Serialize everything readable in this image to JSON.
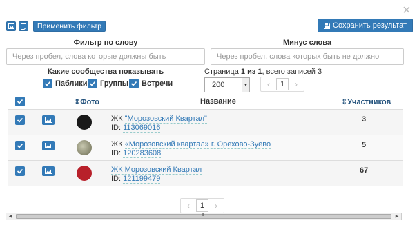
{
  "toolbar": {
    "filter_button": "Применить фильтр",
    "save_button": "Сохранить результат",
    "close_symbol": "×"
  },
  "filters": {
    "word_label": "Фильтр по слову",
    "word_placeholder": "Через пробел, слова которые должны быть",
    "minus_label": "Минус слова",
    "minus_placeholder": "Через пробел, слова которых быть не должно",
    "communities_label": "Какие сообщества показывать",
    "types": [
      {
        "label": "Паблики",
        "checked": true
      },
      {
        "label": "Группы",
        "checked": true
      },
      {
        "label": "Встречи",
        "checked": true
      }
    ]
  },
  "paging": {
    "info_prefix": "Страница ",
    "current": "1",
    "of_word": " из ",
    "total": "1",
    "records_text": ", всего записей 3",
    "per_page": "200",
    "page_number": "1",
    "prev_symbol": "‹",
    "next_symbol": "›"
  },
  "table": {
    "col_photo": "Фото",
    "col_name": "Название",
    "col_members": "Участников",
    "rows": [
      {
        "prefix": "ЖК ",
        "link": "\"Морозовский Квартал\"",
        "suffix": "",
        "id": "113069016",
        "members": "3",
        "avatar_color": "#1a1a1a"
      },
      {
        "prefix": "ЖК ",
        "link": "«Морозовский квартал» г. Орехово-Зуево",
        "suffix": "",
        "id": "120283608",
        "members": "5",
        "avatar_color": "#8a8a6a"
      },
      {
        "prefix": "",
        "link": "ЖК Морозовский Квартал",
        "suffix": "",
        "id": "121199479",
        "members": "67",
        "avatar_color": "#b8202a"
      }
    ],
    "id_prefix": "ID: "
  },
  "bottom_pager": {
    "page_number": "1",
    "prev_symbol": "‹",
    "next_symbol": "›"
  },
  "scrollbar": {
    "grip": "III",
    "left_arrow": "◀",
    "right_arrow": "▶"
  }
}
